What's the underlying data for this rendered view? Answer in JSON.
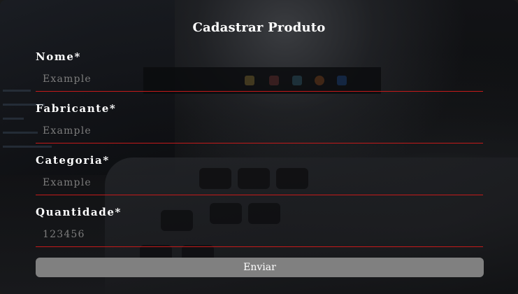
{
  "form": {
    "title": "Cadastrar Produto",
    "fields": [
      {
        "label": "Nome*",
        "placeholder": "Example",
        "value": ""
      },
      {
        "label": "Fabricante*",
        "placeholder": "Example",
        "value": ""
      },
      {
        "label": "Categoria*",
        "placeholder": "Example",
        "value": ""
      },
      {
        "label": "Quantidade*",
        "placeholder": "123456",
        "value": ""
      }
    ],
    "submit_label": "Enviar"
  },
  "colors": {
    "input_underline": "#c41a1a",
    "button_background": "#808080",
    "text": "#ffffff",
    "placeholder": "#7d7d7d"
  }
}
